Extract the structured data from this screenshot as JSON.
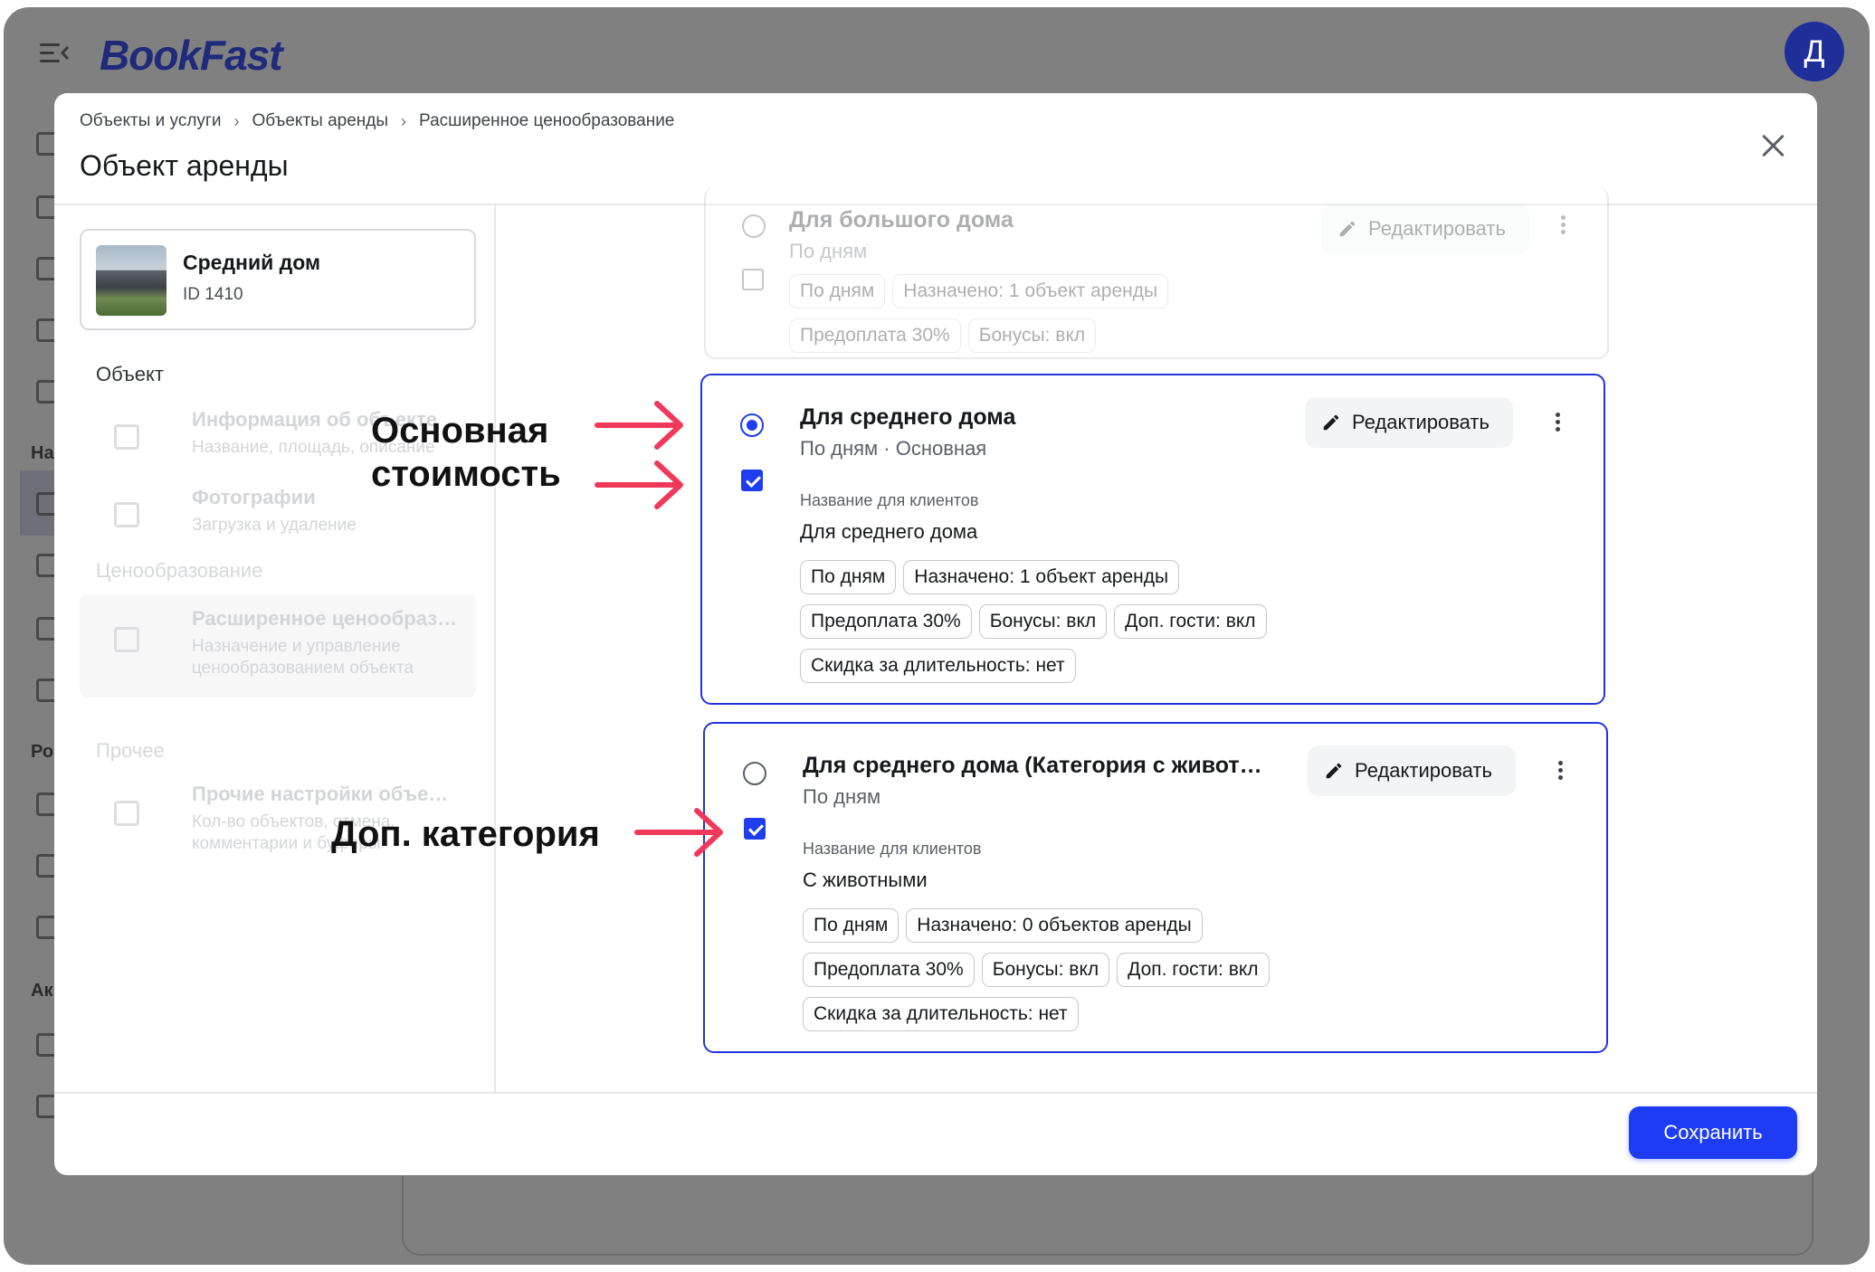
{
  "app": {
    "logo": "BookFast",
    "user_initial": "Д"
  },
  "rail": {
    "labels": [
      "На",
      "Ро",
      "Ак"
    ]
  },
  "breadcrumb": [
    "Объекты и услуги",
    "Объекты аренды",
    "Расширенное ценообразование"
  ],
  "modal_title": "Объект аренды",
  "object": {
    "name": "Средний дом",
    "id": "ID 1410"
  },
  "side": {
    "section_object": "Объект",
    "item_info_title": "Информация об объекте",
    "item_info_desc": "Название, площадь, описание",
    "item_photos_title": "Фотографии",
    "item_photos_desc": "Загрузка и удаление",
    "section_pricing": "Ценообразование",
    "item_pricing_title": "Расширенное ценообраз…",
    "item_pricing_desc": "Назначение и управление ценообразованием объекта",
    "section_other": "Прочее",
    "item_other_title": "Прочие настройки объе…",
    "item_other_desc": "Кол-во объектов, отмена, комментарии и буферы"
  },
  "cards": [
    {
      "title": "Для большого дома",
      "subtitle": "По дням",
      "edit_label": "Редактировать",
      "chips": [
        "По дням",
        "Назначено: 1 объект аренды",
        "Предоплата 30%",
        "Бонусы: вкл"
      ]
    },
    {
      "title": "Для среднего дома",
      "subtitle": "По дням · Основная",
      "edit_label": "Редактировать",
      "client_label": "Название для клиентов",
      "client_value": "Для среднего дома",
      "chips": [
        "По дням",
        "Назначено: 1 объект аренды",
        "Предоплата 30%",
        "Бонусы: вкл",
        "Доп. гости: вкл",
        "Скидка за длительность: нет"
      ]
    },
    {
      "title": "Для среднего дома (Категория с живот…",
      "subtitle": "По дням",
      "edit_label": "Редактировать",
      "client_label": "Название для клиентов",
      "client_value": "С животными",
      "chips": [
        "По дням",
        "Назначено: 0 объектов аренды",
        "Предоплата 30%",
        "Бонусы: вкл",
        "Доп. гости: вкл",
        "Скидка за длительность: нет"
      ]
    }
  ],
  "save_label": "Сохранить",
  "annotations": {
    "main_line1": "Основная",
    "main_line2": "стоимость",
    "extra": "Доп. категория"
  },
  "colors": {
    "accent": "#1d3cf3",
    "annotation_arrow": "#f0395a",
    "overlay": "#808080"
  }
}
